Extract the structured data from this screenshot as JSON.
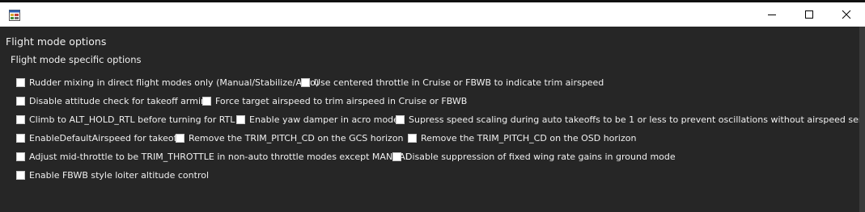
{
  "window": {
    "icon": "app-form-icon",
    "controls": [
      "minimize-icon",
      "maximize-icon",
      "close-icon"
    ]
  },
  "group": {
    "title": "Flight mode options",
    "subtitle": "Flight mode specific options"
  },
  "options": [
    {
      "label": "Rudder mixing in direct flight modes only (Manual/Stabilize/Acro)",
      "checked": false
    },
    {
      "label": "Use centered throttle in Cruise or FBWB to indicate trim airspeed",
      "checked": false
    },
    {
      "label": "Disable attitude check for takeoff arming",
      "checked": false
    },
    {
      "label": "Force target airspeed to trim airspeed in Cruise or FBWB",
      "checked": false
    },
    {
      "label": "Climb to ALT_HOLD_RTL before turning for RTL",
      "checked": false
    },
    {
      "label": "Enable yaw damper in acro mode",
      "checked": false
    },
    {
      "label": "Supress speed scaling during auto takeoffs to be 1 or less to prevent oscillations without airspeed sensor.",
      "checked": false
    },
    {
      "label": "EnableDefaultAirspeed for takeoff",
      "checked": false
    },
    {
      "label": "Remove the TRIM_PITCH_CD on the GCS horizon",
      "checked": false
    },
    {
      "label": "Remove the TRIM_PITCH_CD on the OSD horizon",
      "checked": false
    },
    {
      "label": "Adjust mid-throttle to be TRIM_THROTTLE in non-auto throttle modes except MANUAL",
      "checked": false
    },
    {
      "label": "Disable suppression of fixed wing rate gains in ground mode",
      "checked": false
    },
    {
      "label": "Enable FBWB style loiter altitude control",
      "checked": false
    }
  ]
}
